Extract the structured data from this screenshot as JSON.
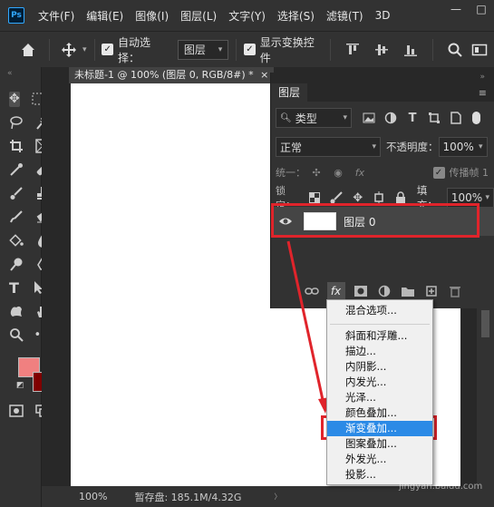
{
  "app": {
    "logo": "Ps"
  },
  "menu": [
    "文件(F)",
    "编辑(E)",
    "图像(I)",
    "图层(L)",
    "文字(Y)",
    "选择(S)",
    "滤镜(T)",
    "3D"
  ],
  "window_controls": {
    "minimize": "—",
    "restore": "□"
  },
  "options_bar": {
    "auto_select_label": "自动选择：",
    "auto_select_value": "图层",
    "show_transform_label": "显示变换控件"
  },
  "document": {
    "tab_title": "未标题-1 @ 100% (图层 0, RGB/8#) *",
    "tab_close": "×"
  },
  "status_bar": {
    "zoom": "100%",
    "scratch": "暂存盘: 185.1M/4.32G"
  },
  "colors": {
    "foreground": "#f08080",
    "background": "#800000",
    "accent": "#2b8ae6",
    "annotation": "#e0242b"
  },
  "layers_panel": {
    "title": "图层",
    "filter_label": "类型",
    "blend_mode": "正常",
    "opacity_label": "不透明度：",
    "opacity_value": "100%",
    "unify_label": "统一：",
    "propagate_label": "传播帧 1",
    "lock_label": "锁定：",
    "fill_label": "填充：",
    "fill_value": "100%",
    "layer_name": "图层 0"
  },
  "fx_menu": {
    "items": [
      "混合选项...",
      "斜面和浮雕...",
      "描边...",
      "内阴影...",
      "内发光...",
      "光泽...",
      "颜色叠加...",
      "渐变叠加...",
      "图案叠加...",
      "外发光...",
      "投影..."
    ],
    "highlighted": "渐变叠加..."
  },
  "watermark": {
    "text": "jingyan.baidu.com"
  }
}
